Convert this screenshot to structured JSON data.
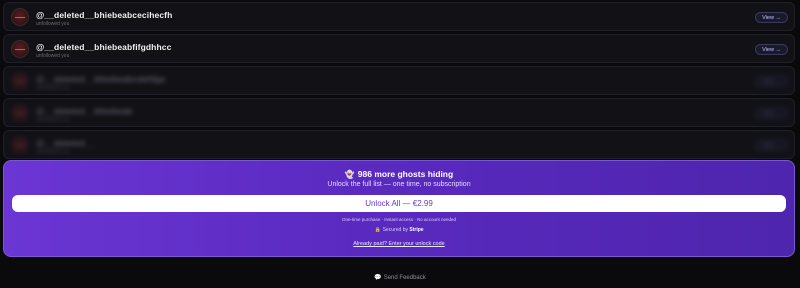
{
  "rows": [
    {
      "username": "@__deleted__bhiebeabcecihecfh",
      "sub": "unfollowed you",
      "view": "View →"
    },
    {
      "username": "@__deleted__bhiebeabfifgdhhcc",
      "sub": "unfollowed you",
      "view": "View →"
    }
  ],
  "blurred_rows": [
    {
      "username": "@__deleted__bhiebeabcdehfge",
      "sub": "unfollowed you",
      "view": "View →"
    },
    {
      "username": "@__deleted__bhiebeab",
      "sub": "unfollowed you",
      "view": "View →"
    },
    {
      "username": "@__deleted__",
      "sub": "unfollowed you",
      "view": "View →"
    }
  ],
  "paywall": {
    "ghost_icon": "👻",
    "title": "986 more ghosts hiding",
    "subtitle": "Unlock the full list — one time, no subscription",
    "button": "Unlock All — €2.99",
    "fine_print": "One-time purchase · Instant access · No account needed",
    "secured_prefix": "Secured by",
    "secured_brand": "Stripe",
    "already_paid": "Already paid? Enter your unlock code"
  },
  "footer": {
    "feedback": "Send Feedback"
  },
  "colors": {
    "background": "#0a0a0c",
    "accent": "#6b36d4",
    "button_text": "#6a34d8"
  }
}
